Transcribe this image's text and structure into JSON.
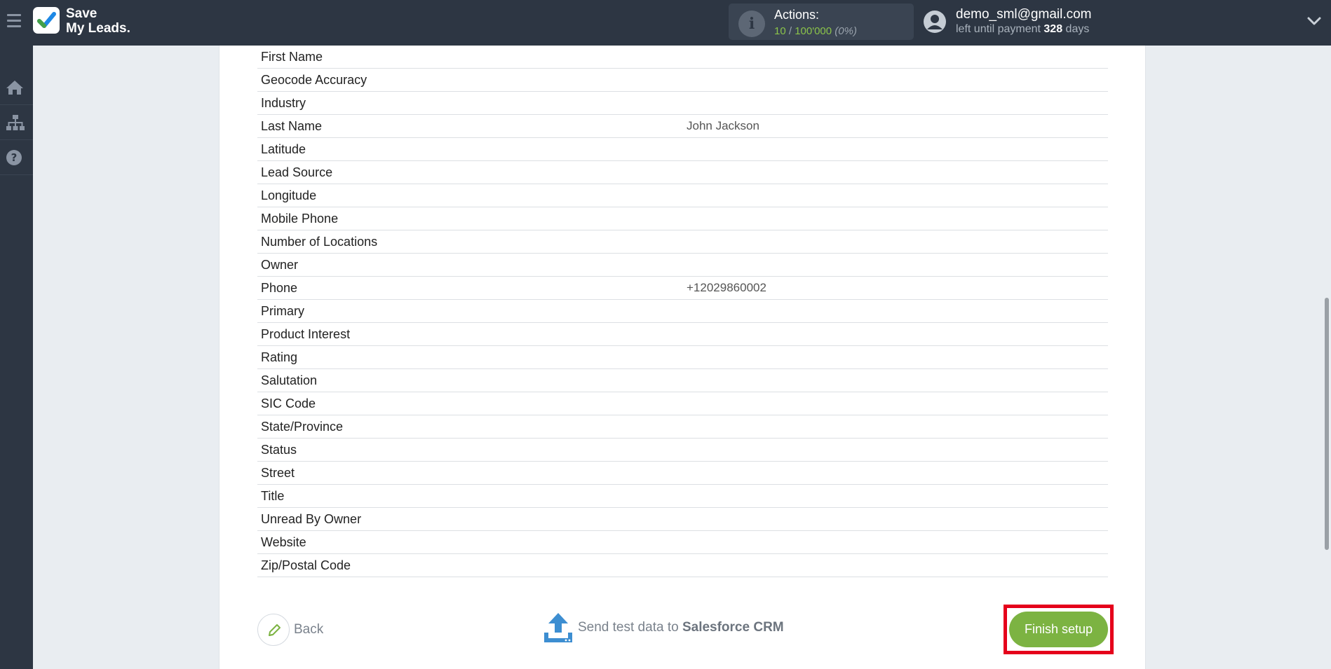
{
  "brand": {
    "line1": "Save",
    "line2": "My Leads."
  },
  "actions": {
    "label": "Actions:",
    "used": "10",
    "separator": " / ",
    "limit": "100'000",
    "percent": "(0%)"
  },
  "user": {
    "email": "demo_sml@gmail.com",
    "payment_prefix": "left until payment ",
    "days": "328",
    "payment_suffix": " days"
  },
  "sidebar": {
    "items": [
      {
        "icon": "home-icon"
      },
      {
        "icon": "sitemap-icon"
      },
      {
        "icon": "help-icon"
      }
    ]
  },
  "fields": [
    {
      "name": "First Name",
      "value": ""
    },
    {
      "name": "Geocode Accuracy",
      "value": ""
    },
    {
      "name": "Industry",
      "value": ""
    },
    {
      "name": "Last Name",
      "value": "John Jackson"
    },
    {
      "name": "Latitude",
      "value": ""
    },
    {
      "name": "Lead Source",
      "value": ""
    },
    {
      "name": "Longitude",
      "value": ""
    },
    {
      "name": "Mobile Phone",
      "value": ""
    },
    {
      "name": "Number of Locations",
      "value": ""
    },
    {
      "name": "Owner",
      "value": ""
    },
    {
      "name": "Phone",
      "value": "+12029860002"
    },
    {
      "name": "Primary",
      "value": ""
    },
    {
      "name": "Product Interest",
      "value": ""
    },
    {
      "name": "Rating",
      "value": ""
    },
    {
      "name": "Salutation",
      "value": ""
    },
    {
      "name": "SIC Code",
      "value": ""
    },
    {
      "name": "State/Province",
      "value": ""
    },
    {
      "name": "Status",
      "value": ""
    },
    {
      "name": "Street",
      "value": ""
    },
    {
      "name": "Title",
      "value": ""
    },
    {
      "name": "Unread By Owner",
      "value": ""
    },
    {
      "name": "Website",
      "value": ""
    },
    {
      "name": "Zip/Postal Code",
      "value": ""
    }
  ],
  "footer": {
    "back_label": "Back",
    "send_prefix": "Send test data to ",
    "send_target": "Salesforce CRM",
    "finish_label": "Finish setup"
  },
  "colors": {
    "accent_green": "#7cb342",
    "topbar": "#2d3643",
    "highlight_red": "#e5001b"
  }
}
